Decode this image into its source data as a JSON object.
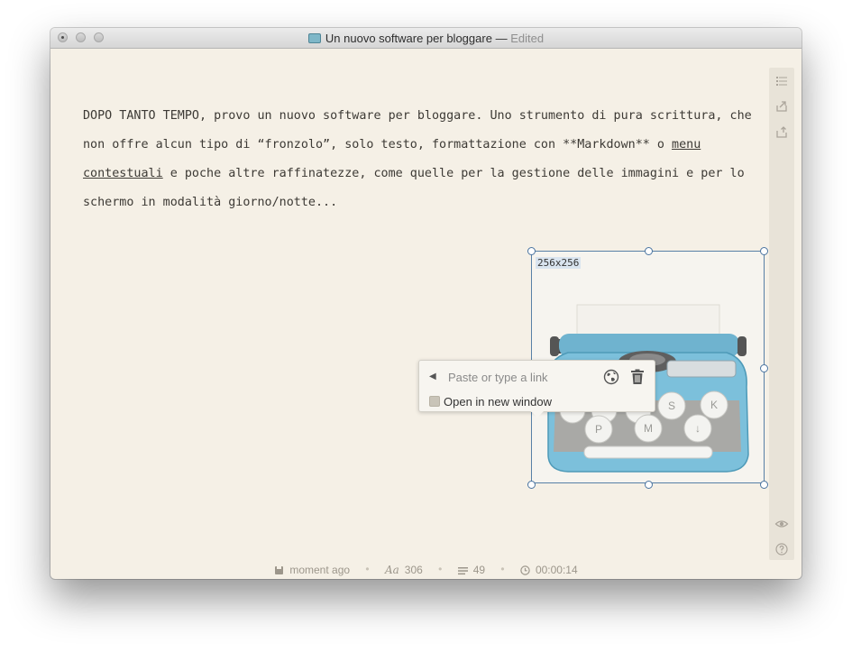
{
  "window": {
    "title": "Un nuovo software per bloggare",
    "title_separator": "—",
    "title_status": "Edited",
    "document_icon": "typewriter-icon"
  },
  "editor": {
    "text_before_link": "DOPO TANTO TEMPO, provo un nuovo software per bloggare. Uno strumento di pura scrittura, che non offre alcun tipo di “fronzolo”, solo testo, formattazione con **Markdown** o ",
    "link_text": "menu contestuali",
    "text_after_link": " e poche altre raffinatezze, come quelle per la gestione delle immagini e per lo schermo in modalità giorno/notte..."
  },
  "image": {
    "size_label": "256x256",
    "content": "typewriter-illustration",
    "key_letters": [
      "S",
      "K",
      "P",
      "M",
      "↓"
    ]
  },
  "link_popup": {
    "placeholder": "Paste or type a link",
    "back_icon": "triangle-left-icon",
    "globe_icon": "globe-icon",
    "trash_icon": "trash-icon",
    "checkbox_label": "Open in new window",
    "checkbox_checked": false
  },
  "sidebar": {
    "icons": [
      "list-icon",
      "export-icon",
      "share-icon",
      "eye-icon",
      "help-icon"
    ]
  },
  "statusbar": {
    "saved": "moment ago",
    "font_symbol": "Aa",
    "characters": "306",
    "words": "49",
    "time": "00:00:14"
  },
  "colors": {
    "background": "#f5f0e6",
    "text": "#3d3a35",
    "selection_frame": "#5880a6",
    "muted": "#9c968b"
  }
}
